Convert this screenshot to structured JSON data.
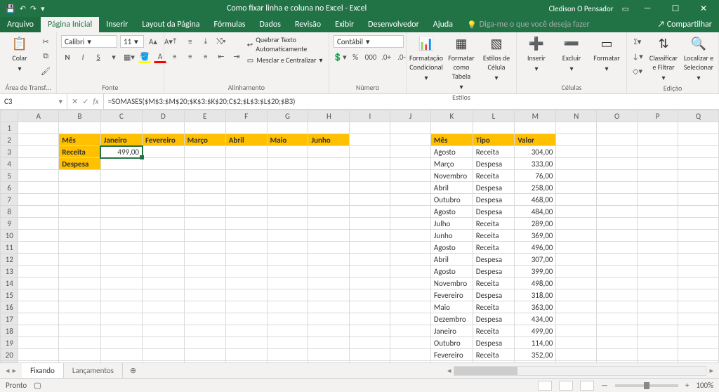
{
  "title": "Como fixar linha e coluna no Excel - Excel",
  "user": "Cledison O Pensador",
  "menubar": {
    "file": "Arquivo",
    "tabs": [
      "Página Inicial",
      "Inserir",
      "Layout da Página",
      "Fórmulas",
      "Dados",
      "Revisão",
      "Exibir",
      "Desenvolvedor",
      "Ajuda"
    ],
    "tellme": "Diga-me o que você deseja fazer",
    "share": "Compartilhar"
  },
  "ribbon": {
    "clipboard": {
      "paste": "Colar",
      "label": "Área de Transf…"
    },
    "font": {
      "name": "Calibri",
      "size": "11",
      "label": "Fonte"
    },
    "alignment": {
      "wrap": "Quebrar Texto Automaticamente",
      "merge": "Mesclar e Centralizar",
      "label": "Alinhamento"
    },
    "number": {
      "format": "Contábil",
      "label": "Número"
    },
    "styles": {
      "cond": "Formatação Condicional",
      "table": "Formatar como Tabela",
      "cell": "Estilos de Célula",
      "label": "Estilos"
    },
    "cells": {
      "insert": "Inserir",
      "delete": "Excluir",
      "format": "Formatar",
      "label": "Células"
    },
    "editing": {
      "sort": "Classificar e Filtrar",
      "find": "Localizar e Selecionar",
      "label": "Edição"
    }
  },
  "fx": {
    "cell": "C3",
    "formula": "=SOMASES($M$3:$M$20;$K$3:$K$20;C$2;$L$3:$L$20;$B3)"
  },
  "columns": [
    "A",
    "B",
    "C",
    "D",
    "E",
    "F",
    "G",
    "H",
    "I",
    "J",
    "K",
    "L",
    "M",
    "N",
    "O",
    "P",
    "Q"
  ],
  "left_table": {
    "header_row": [
      "Mês",
      "Janeiro",
      "Fevereiro",
      "Março",
      "Abril",
      "Maio",
      "Junho"
    ],
    "rows": [
      {
        "label": "Receita",
        "values": [
          "499,00",
          "",
          "",
          "",
          "",
          ""
        ]
      },
      {
        "label": "Despesa",
        "values": [
          "",
          "",
          "",
          "",
          "",
          ""
        ]
      }
    ]
  },
  "right_table": {
    "headers": [
      "Mês",
      "Tipo",
      "Valor"
    ],
    "rows": [
      [
        "Agosto",
        "Receita",
        "304,00"
      ],
      [
        "Março",
        "Despesa",
        "333,00"
      ],
      [
        "Novembro",
        "Receita",
        "76,00"
      ],
      [
        "Abril",
        "Despesa",
        "258,00"
      ],
      [
        "Outubro",
        "Despesa",
        "468,00"
      ],
      [
        "Agosto",
        "Despesa",
        "484,00"
      ],
      [
        "Julho",
        "Receita",
        "289,00"
      ],
      [
        "Junho",
        "Receita",
        "369,00"
      ],
      [
        "Agosto",
        "Receita",
        "496,00"
      ],
      [
        "Abril",
        "Despesa",
        "307,00"
      ],
      [
        "Agosto",
        "Despesa",
        "399,00"
      ],
      [
        "Novembro",
        "Receita",
        "498,00"
      ],
      [
        "Fevereiro",
        "Despesa",
        "318,00"
      ],
      [
        "Maio",
        "Receita",
        "363,00"
      ],
      [
        "Dezembro",
        "Despesa",
        "434,00"
      ],
      [
        "Janeiro",
        "Receita",
        "499,00"
      ],
      [
        "Outubro",
        "Despesa",
        "114,00"
      ],
      [
        "Fevereiro",
        "Receita",
        "352,00"
      ]
    ]
  },
  "sheets": {
    "active": "Fixando",
    "other": "Lançamentos"
  },
  "status": {
    "ready": "Pronto",
    "zoom": "100%"
  }
}
